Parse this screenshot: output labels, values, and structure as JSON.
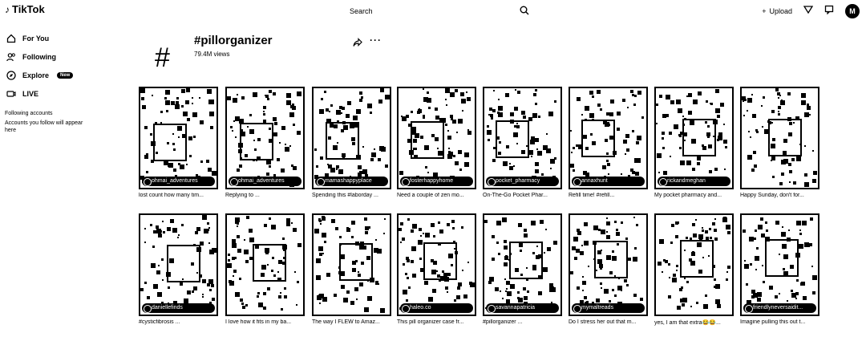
{
  "app": {
    "logo": "TikTok"
  },
  "search": {
    "placeholder": "Search"
  },
  "header_actions": {
    "upload": "Upload",
    "avatar_initial": "M"
  },
  "sidebar": {
    "items": [
      {
        "label": "For You",
        "icon": "home-icon"
      },
      {
        "label": "Following",
        "icon": "users-icon"
      },
      {
        "label": "Explore",
        "icon": "compass-icon",
        "badge": "New"
      },
      {
        "label": "LIVE",
        "icon": "live-icon"
      }
    ],
    "following_title": "Following accounts",
    "following_desc": "Accounts you follow will appear here"
  },
  "tag": {
    "symbol": "#",
    "title": "#pillorganizer",
    "views": "79.4M views"
  },
  "videos": [
    {
      "user": "ohmai_adventures",
      "caption": "lost count how many tim..."
    },
    {
      "user": "ohmai_adventures",
      "caption": "Replying to ..."
    },
    {
      "user": "mamashappyplace",
      "caption": "Spending this #laborday ..."
    },
    {
      "user": "fosterhappyhome",
      "caption": "Need a couple of zen mo..."
    },
    {
      "user": "pocket_pharmacy",
      "caption": "On-The-Go Pocket Phar..."
    },
    {
      "user": "annaxhunt",
      "caption": "Refill time! #refill..."
    },
    {
      "user": "rickandmeghan",
      "caption": "My pocket pharmacy and..."
    },
    {
      "user": "",
      "caption": "Happy Sunday, don't for..."
    },
    {
      "user": "daniellefinds",
      "caption": "#cysticfibrosis ..."
    },
    {
      "user": "",
      "caption": "I love how it fits in my ba..."
    },
    {
      "user": "",
      "caption": "The way I FLEW to Amaz..."
    },
    {
      "user": "haleo.co",
      "caption": "This pill organizer case fr..."
    },
    {
      "user": "savannapatricia",
      "caption": "#pillorganizer ..."
    },
    {
      "user": "mymaltreads",
      "caption": "Do I stress her out that m..."
    },
    {
      "user": "",
      "caption": "yes, I am that extra😂😂..."
    },
    {
      "user": "friendlyneversaidit...",
      "caption": "Imagine pulling this out t..."
    }
  ]
}
